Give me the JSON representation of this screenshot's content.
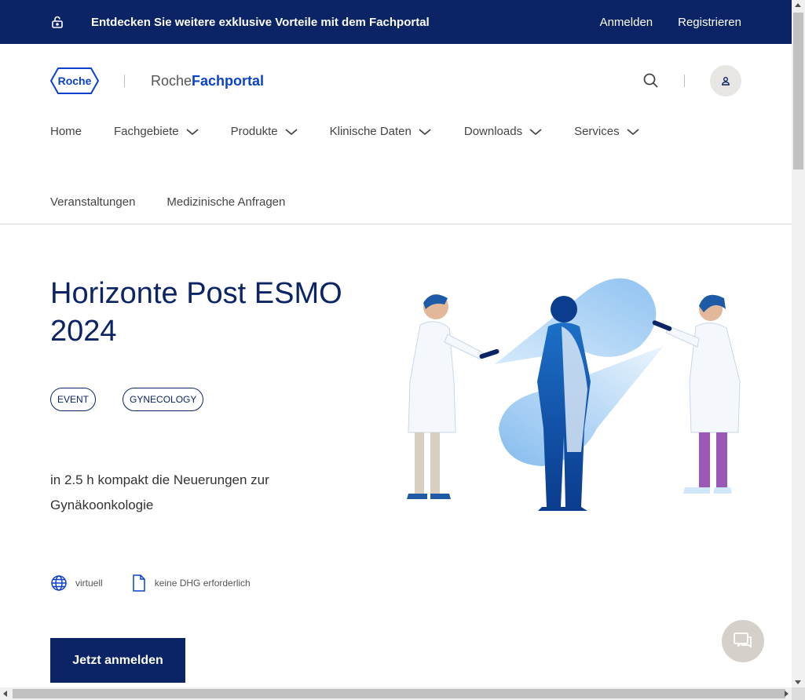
{
  "topbar": {
    "promo": "Entdecken Sie weitere exklusive Vorteile mit dem Fachportal",
    "login": "Anmelden",
    "register": "Registrieren",
    "icon": "lock-icon"
  },
  "header": {
    "logo_text": "Roche",
    "brand_prefix": "Roche",
    "brand_bold": "Fachportal",
    "search_icon": "search-icon",
    "user_icon": "user-icon"
  },
  "nav": {
    "row1": [
      {
        "label": "Home",
        "dropdown": false
      },
      {
        "label": "Fachgebiete",
        "dropdown": true
      },
      {
        "label": "Produkte",
        "dropdown": true
      },
      {
        "label": "Klinische Daten",
        "dropdown": true
      },
      {
        "label": "Downloads",
        "dropdown": true
      },
      {
        "label": "Services",
        "dropdown": true
      }
    ],
    "row2": [
      {
        "label": "Veranstaltungen"
      },
      {
        "label": "Medizinische Anfragen"
      }
    ]
  },
  "hero": {
    "title": "Horizonte Post ESMO 2024",
    "chips": [
      "EVENT",
      "GYNECOLOGY"
    ],
    "lead": "in 2.5 h kompakt die Neuerungen zur Gynäkoonkologie",
    "meta": [
      {
        "icon": "globe-icon",
        "label": "virtuell"
      },
      {
        "icon": "document-icon",
        "label": "keine DHG erforderlich"
      }
    ],
    "cta": "Jetzt anmelden"
  },
  "chat": {
    "icon": "chat-icon"
  },
  "colors": {
    "navy": "#0b2466",
    "roche_blue": "#0b41cd",
    "chat_bg": "#d6d0ca"
  }
}
